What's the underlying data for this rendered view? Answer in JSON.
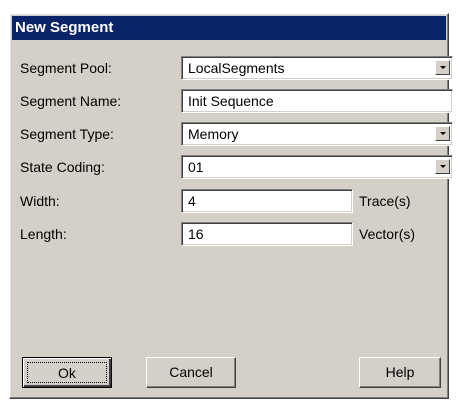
{
  "dialog": {
    "title": "New Segment"
  },
  "fields": {
    "segment_pool": {
      "label": "Segment Pool:",
      "value": "LocalSegments"
    },
    "segment_name": {
      "label": "Segment Name:",
      "value": "Init Sequence"
    },
    "segment_type": {
      "label": "Segment Type:",
      "value": "Memory"
    },
    "state_coding": {
      "label": "State Coding:",
      "value": "01"
    },
    "width": {
      "label": "Width:",
      "value": "4",
      "unit": "Trace(s)"
    },
    "length": {
      "label": "Length:",
      "value": "16",
      "unit": "Vector(s)"
    }
  },
  "buttons": {
    "ok": "Ok",
    "cancel": "Cancel",
    "help": "Help"
  }
}
